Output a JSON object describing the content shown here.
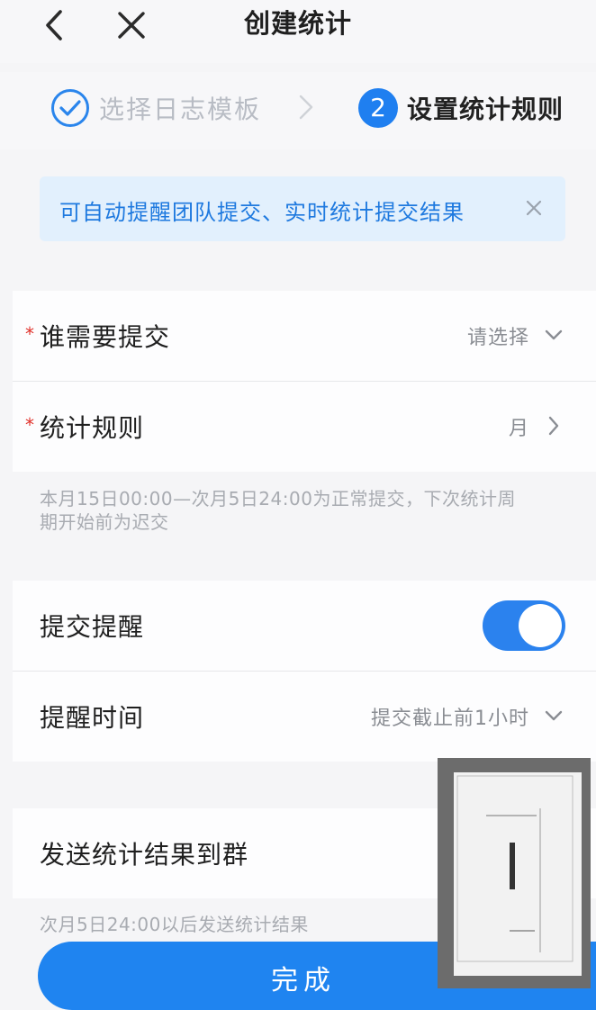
{
  "header": {
    "title": "创建统计",
    "back_icon": "back-arrow-icon",
    "close_icon": "close-icon"
  },
  "steps": {
    "step1": {
      "label": "选择日志模板",
      "state": "completed"
    },
    "step2": {
      "number": "2",
      "label": "设置统计规则",
      "state": "active"
    }
  },
  "banner": {
    "text": "可自动提醒团队提交、实时统计提交结果"
  },
  "form": {
    "who_submits": {
      "label": "谁需要提交",
      "value": "请选择"
    },
    "stat_rule": {
      "label": "统计规则",
      "value": "月"
    },
    "rule_note_line1": "本月15日00:00—次月5日24:00为正常提交，下次统计周",
    "rule_note_line2": "期开始前为迟交",
    "reminder": {
      "label": "提交提醒",
      "enabled": true
    },
    "reminder_time": {
      "label": "提醒时间",
      "value": "提交截止前1小时"
    },
    "send_to_group": {
      "label": "发送统计结果到群"
    },
    "send_note": "次月5日24:00以后发送统计结果"
  },
  "done_button": {
    "label": "完成"
  },
  "colors": {
    "accent": "#1f84f0",
    "banner_bg": "#e2f0fd",
    "required": "#e0312a"
  }
}
